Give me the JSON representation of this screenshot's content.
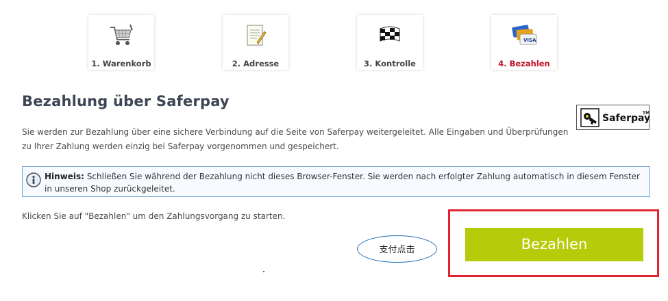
{
  "steps": [
    {
      "label": "1. Warenkorb",
      "icon": "shopping-cart-icon",
      "active": false
    },
    {
      "label": "2. Adresse",
      "icon": "notepad-icon",
      "active": false
    },
    {
      "label": "3. Kontrolle",
      "icon": "checkered-flag-icon",
      "active": false
    },
    {
      "label": "4. Bezahlen",
      "icon": "credit-cards-icon",
      "active": true
    }
  ],
  "page": {
    "title": "Bezahlung über Saferpay",
    "description": "Sie werden zur Bezahlung über eine sichere Verbindung auf die Seite von Saferpay weitergeleitet. Alle Eingaben und Überprüfungen zu Ihrer Zahlung werden einzig bei Saferpay vorgenommen und gespeichert.",
    "logo": {
      "name": "Saferpay",
      "tm": "TM"
    }
  },
  "notice": {
    "prefix": "Hinweis:",
    "text": "Schließen Sie während der Bezahlung nicht dieses Browser-Fenster. Sie werden nach erfolgter Zahlung automatisch in diesem Fenster in unseren Shop zurückgeleitet."
  },
  "instruction": "Klicken Sie auf \"Bezahlen\" um den Zahlungsvorgang zu starten.",
  "annotation": {
    "text": "支付点击"
  },
  "pay_button": {
    "label": "Bezahlen"
  },
  "colors": {
    "active_step": "#c0102a",
    "pay_button": "#b6cc0a",
    "highlight_frame": "#e0232e",
    "notice_border": "#6fa3cf",
    "title": "#3c4654"
  }
}
